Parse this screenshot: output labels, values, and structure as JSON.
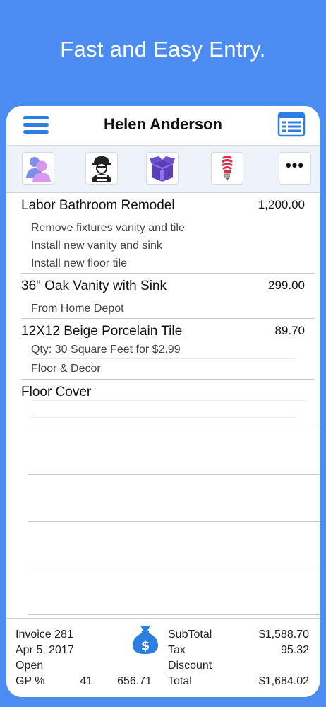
{
  "promo": {
    "headline": "Fast and Easy Entry."
  },
  "nav": {
    "title": "Helen Anderson"
  },
  "toolbar": {
    "more_label": "•••"
  },
  "items": [
    {
      "title": "Labor  Bathroom Remodel",
      "amount": "1,200.00",
      "notes": [
        "Remove fixtures vanity and tile",
        "Install new vanity and sink",
        "Install new floor tile"
      ]
    },
    {
      "title": "36\" Oak Vanity with Sink",
      "amount": "299.00",
      "notes": [
        "From Home Depot"
      ]
    },
    {
      "title": "12X12 Beige Porcelain Tile",
      "amount": "89.70",
      "notes": [
        "Qty: 30 Square Feet for $2.99",
        "Floor & Decor"
      ]
    },
    {
      "title": "Floor Cover",
      "amount": "",
      "notes": []
    }
  ],
  "footer": {
    "invoice": "Invoice 281",
    "date": "Apr 5, 2017",
    "status": "Open",
    "gp_label": "GP %",
    "gp_percent": "41",
    "gp_amount": "656.71",
    "subtotal_label": "SubTotal",
    "subtotal_value": "$1,588.70",
    "tax_label": "Tax",
    "tax_value": "95.32",
    "discount_label": "Discount",
    "discount_value": "",
    "total_label": "Total",
    "total_value": "$1,684.02"
  },
  "colors": {
    "background": "#4a8cf0",
    "accent": "#2b7fe0"
  }
}
